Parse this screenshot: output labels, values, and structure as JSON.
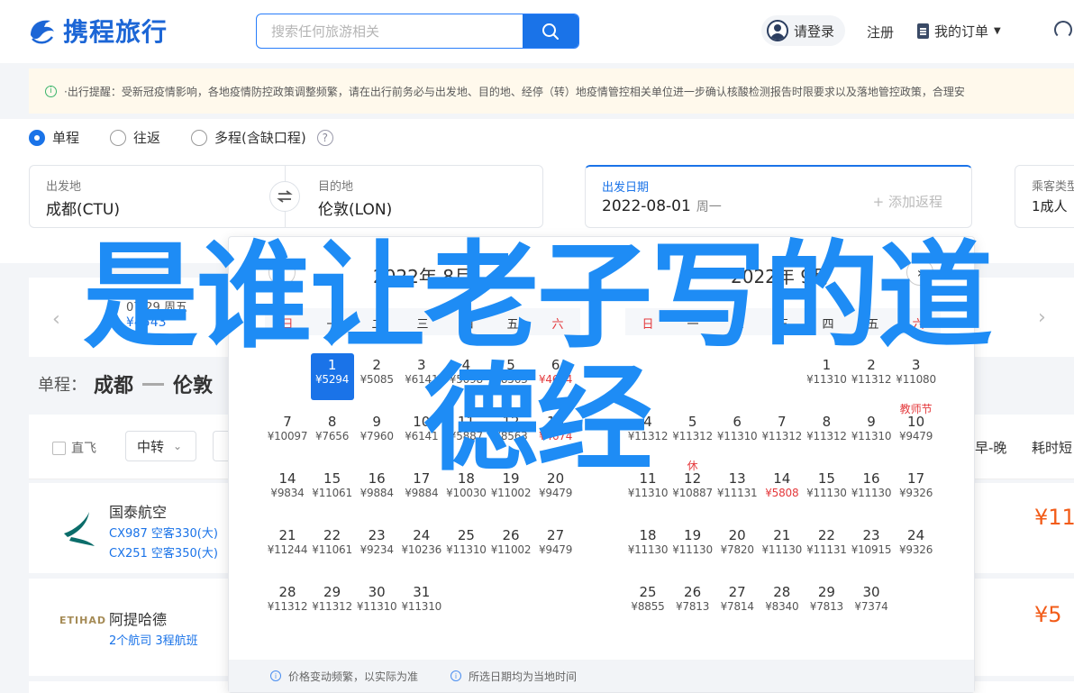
{
  "header": {
    "logo_text": "携程旅行",
    "search_placeholder": "搜索任何旅游相关",
    "login_label": "请登录",
    "register_label": "注册",
    "orders_label": "我的订单"
  },
  "notice": {
    "text": "·出行提醒：受新冠疫情影响，各地疫情防控政策调整频繁，请在出行前务必与出发地、目的地、经停（转）地疫情管控相关单位进一步确认核酸检测报告时限要求以及落地管控政策，合理安"
  },
  "trip_types": [
    {
      "label": "单程",
      "selected": true
    },
    {
      "label": "往返",
      "selected": false
    },
    {
      "label": "多程(含缺口程)",
      "selected": false
    }
  ],
  "form": {
    "from_label": "出发地",
    "from_value": "成都(CTU)",
    "to_label": "目的地",
    "to_value": "伦敦(LON)",
    "date_label": "出发日期",
    "date_value": "2022-08-01",
    "date_weekday": "周一",
    "add_return": "+ 添加返程",
    "pax_label": "乘客类型",
    "pax_value": "1成人"
  },
  "date_strip": {
    "date_partial": "07-29 周五",
    "price_partial": "¥4543"
  },
  "route": {
    "prefix": "单程：",
    "from": "成都",
    "to": "伦敦"
  },
  "filters": {
    "direct": "直飞",
    "transfer": "中转",
    "sort_a": "早-晚",
    "sort_b": "耗时短"
  },
  "flights": [
    {
      "airline": "国泰航空",
      "line1": "CX987 空客330(大)",
      "line2": "CX251 空客350(大)",
      "price_partial": "¥11"
    },
    {
      "airline": "阿提哈德",
      "line1": "2个航司  3程航班",
      "line2": "",
      "price_partial": "¥5",
      "logo_text": "ETIHAD"
    }
  ],
  "calendar": {
    "months": [
      {
        "title": "2022年 8月",
        "weekdays": [
          "日",
          "一",
          "二",
          "三",
          "四",
          "五",
          "六"
        ],
        "days": [
          {
            "d": "1",
            "p": "¥5294",
            "selected": true
          },
          {
            "d": "2",
            "p": "¥5085"
          },
          {
            "d": "3",
            "p": "¥6141"
          },
          {
            "d": "4",
            "p": "¥5098"
          },
          {
            "d": "5",
            "p": "¥8563"
          },
          {
            "d": "6",
            "p": "¥4674",
            "red": true
          },
          {
            "d": "7",
            "p": "¥10097"
          },
          {
            "d": "8",
            "p": "¥7656"
          },
          {
            "d": "9",
            "p": "¥7960"
          },
          {
            "d": "10",
            "p": "¥6141"
          },
          {
            "d": "11",
            "p": "¥5887"
          },
          {
            "d": "12",
            "p": "¥8563"
          },
          {
            "d": "13",
            "p": "¥4674",
            "red": true
          },
          {
            "d": "14",
            "p": "¥9834"
          },
          {
            "d": "15",
            "p": "¥11061"
          },
          {
            "d": "16",
            "p": "¥9884"
          },
          {
            "d": "17",
            "p": "¥9884"
          },
          {
            "d": "18",
            "p": "¥10030"
          },
          {
            "d": "19",
            "p": "¥11002"
          },
          {
            "d": "20",
            "p": "¥9479"
          },
          {
            "d": "21",
            "p": "¥11244"
          },
          {
            "d": "22",
            "p": "¥11061"
          },
          {
            "d": "23",
            "p": "¥9234"
          },
          {
            "d": "24",
            "p": "¥10236"
          },
          {
            "d": "25",
            "p": "¥11310"
          },
          {
            "d": "26",
            "p": "¥11002"
          },
          {
            "d": "27",
            "p": "¥9479"
          },
          {
            "d": "28",
            "p": "¥11312"
          },
          {
            "d": "29",
            "p": "¥11312"
          },
          {
            "d": "30",
            "p": "¥11310"
          },
          {
            "d": "31",
            "p": "¥11310"
          }
        ]
      },
      {
        "title": "2022年 9月",
        "weekdays": [
          "日",
          "一",
          "二",
          "三",
          "四",
          "五",
          "六"
        ],
        "days": [
          {
            "d": "1",
            "p": "¥11310"
          },
          {
            "d": "2",
            "p": "¥11312"
          },
          {
            "d": "3",
            "p": "¥11080"
          },
          {
            "d": "4",
            "p": "¥11312"
          },
          {
            "d": "5",
            "p": "¥11312"
          },
          {
            "d": "6",
            "p": "¥11310"
          },
          {
            "d": "7",
            "p": "¥11312"
          },
          {
            "d": "8",
            "p": "¥11312"
          },
          {
            "d": "9",
            "p": "¥11310"
          },
          {
            "d": "10",
            "p": "¥9479",
            "holiday": "教师节"
          },
          {
            "d": "11",
            "p": "¥11310"
          },
          {
            "d": "12",
            "p": "¥10887",
            "holiday": "休"
          },
          {
            "d": "13",
            "p": "¥11131"
          },
          {
            "d": "14",
            "p": "¥5808",
            "red": true
          },
          {
            "d": "15",
            "p": "¥11130"
          },
          {
            "d": "16",
            "p": "¥11130"
          },
          {
            "d": "17",
            "p": "¥9326"
          },
          {
            "d": "18",
            "p": "¥11130"
          },
          {
            "d": "19",
            "p": "¥11130"
          },
          {
            "d": "20",
            "p": "¥7820"
          },
          {
            "d": "21",
            "p": "¥11130"
          },
          {
            "d": "22",
            "p": "¥11131"
          },
          {
            "d": "23",
            "p": "¥10915"
          },
          {
            "d": "24",
            "p": "¥9326"
          },
          {
            "d": "25",
            "p": "¥8855"
          },
          {
            "d": "26",
            "p": "¥7813"
          },
          {
            "d": "27",
            "p": "¥7814"
          },
          {
            "d": "28",
            "p": "¥8340"
          },
          {
            "d": "29",
            "p": "¥7813"
          },
          {
            "d": "30",
            "p": "¥7374"
          }
        ]
      }
    ],
    "footer": [
      "价格变动频繁，以实际为准",
      "所选日期均为当地时间"
    ]
  },
  "overlay": {
    "line1": "是谁让老子写的道",
    "line2": "德经"
  },
  "colors": {
    "brand_blue": "#1a73e8",
    "overlay_blue": "#1e8cf5",
    "price_red": "#e4393c",
    "price_orange": "#f25c19"
  }
}
